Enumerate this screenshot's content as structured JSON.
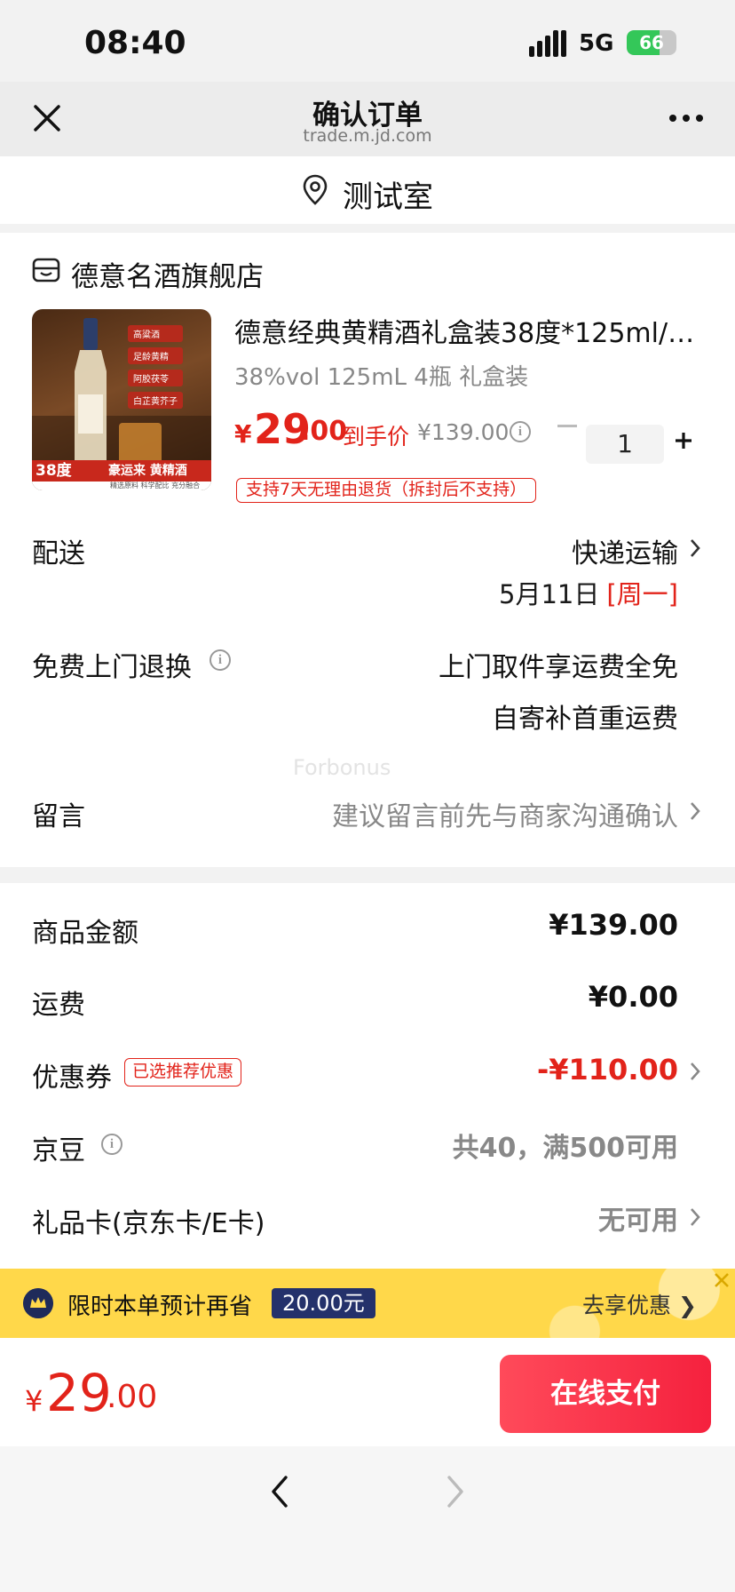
{
  "status_bar": {
    "time": "08:40",
    "network": "5G",
    "battery": "66",
    "battery_level": 0.66
  },
  "nav": {
    "title": "确认订单",
    "subtitle": "trade.m.jd.com"
  },
  "location": {
    "name": "测试室"
  },
  "shop": {
    "name": "德意名酒旗舰店"
  },
  "product": {
    "title": "德意经典黄精酒礼盒装38度*125ml/…",
    "spec": "38%vol 125mL 4瓶 礼盒装",
    "price_symbol": "¥",
    "price_int": "29",
    "price_dec": ".00",
    "final_price_label": "到手价",
    "original_price": "¥139.00",
    "quantity": "1",
    "return_policy": "支持7天无理由退货（拆封后不支持）",
    "image": {
      "badges": [
        "高粱酒",
        "足龄黄精",
        "阿胶茯苓",
        "白芷黄芥子"
      ],
      "degree": "38度",
      "banner": "豪运来 黄精酒",
      "footer": "精选原料 科学配比 充分融合"
    }
  },
  "delivery": {
    "label": "配送",
    "method": "快递运输",
    "date": "5月11日",
    "weekday": "[周一]"
  },
  "free_return": {
    "label": "免费上门退换",
    "line1": "上门取件享运费全免",
    "line2": "自寄补首重运费"
  },
  "watermark": "Forbonus",
  "message": {
    "label": "留言",
    "placeholder": "建议留言前先与商家沟通确认"
  },
  "summary": {
    "goods_label": "商品金额",
    "goods_value": "¥139.00",
    "shipping_label": "运费",
    "shipping_value": "¥0.00",
    "coupon_label": "优惠券",
    "coupon_tag": "已选推荐优惠",
    "coupon_value": "-¥110.00",
    "jingdou_label": "京豆",
    "jingdou_value": "共40，满500可用",
    "giftcard_label": "礼品卡(京东卡/E卡)",
    "giftcard_value": "无可用"
  },
  "promo": {
    "text": "限时本单预计再省",
    "amount": "20.00元",
    "link": "去享优惠 ❯"
  },
  "footer": {
    "total_symbol": "¥",
    "total_int": "29",
    "total_dec": ".00",
    "pay_label": "在线支付"
  },
  "colors": {
    "accent": "#e2231a",
    "promo_bg": "#ffd84a",
    "pay_button": "#f5213e"
  }
}
